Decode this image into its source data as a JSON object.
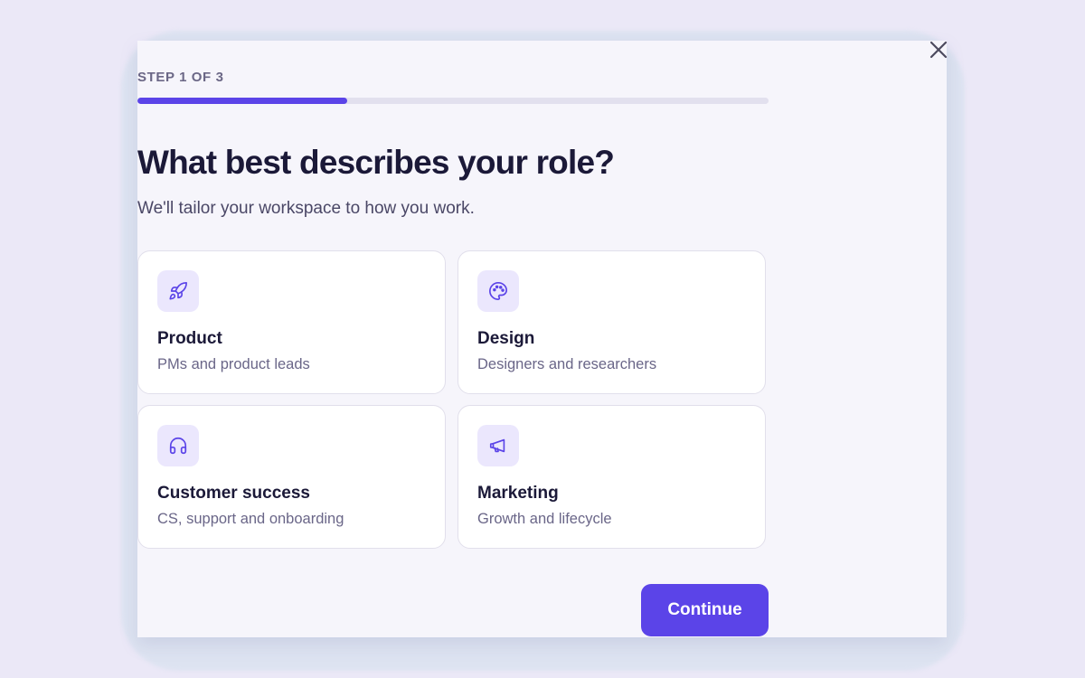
{
  "onboarding": {
    "step_label": "STEP 1 OF 3",
    "progress_fraction": 0.333,
    "title": "What best describes your role?",
    "subtitle": "We'll tailor your workspace to how you work.",
    "continue_label": "Continue",
    "accent_color": "#5b44e8",
    "roles": [
      {
        "title": "Product",
        "description": "PMs and product leads",
        "icon": "rocket-icon"
      },
      {
        "title": "Design",
        "description": "Designers and researchers",
        "icon": "palette-icon"
      },
      {
        "title": "Customer success",
        "description": "CS, support and onboarding",
        "icon": "headphones-icon"
      },
      {
        "title": "Marketing",
        "description": "Growth and lifecycle",
        "icon": "megaphone-icon"
      }
    ]
  }
}
